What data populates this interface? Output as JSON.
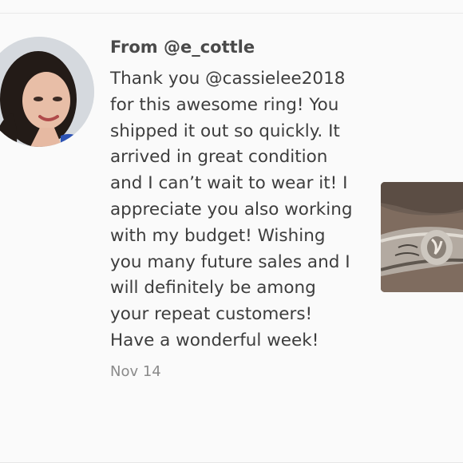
{
  "comment": {
    "author": "From @e_cottle",
    "message": "Thank you @cassielee2018 for this awesome ring! You shipped it out so quickly. It arrived in great condition and I can’t wait to wear it! I appreciate you also working with my budget! Wishing you many future sales and I will definitely be among your repeat customers! Have a wonderful week!",
    "date": "Nov 14"
  },
  "avatar": {
    "icon": "user-avatar-photo"
  },
  "attachment": {
    "icon": "ring-photo-thumbnail"
  }
}
